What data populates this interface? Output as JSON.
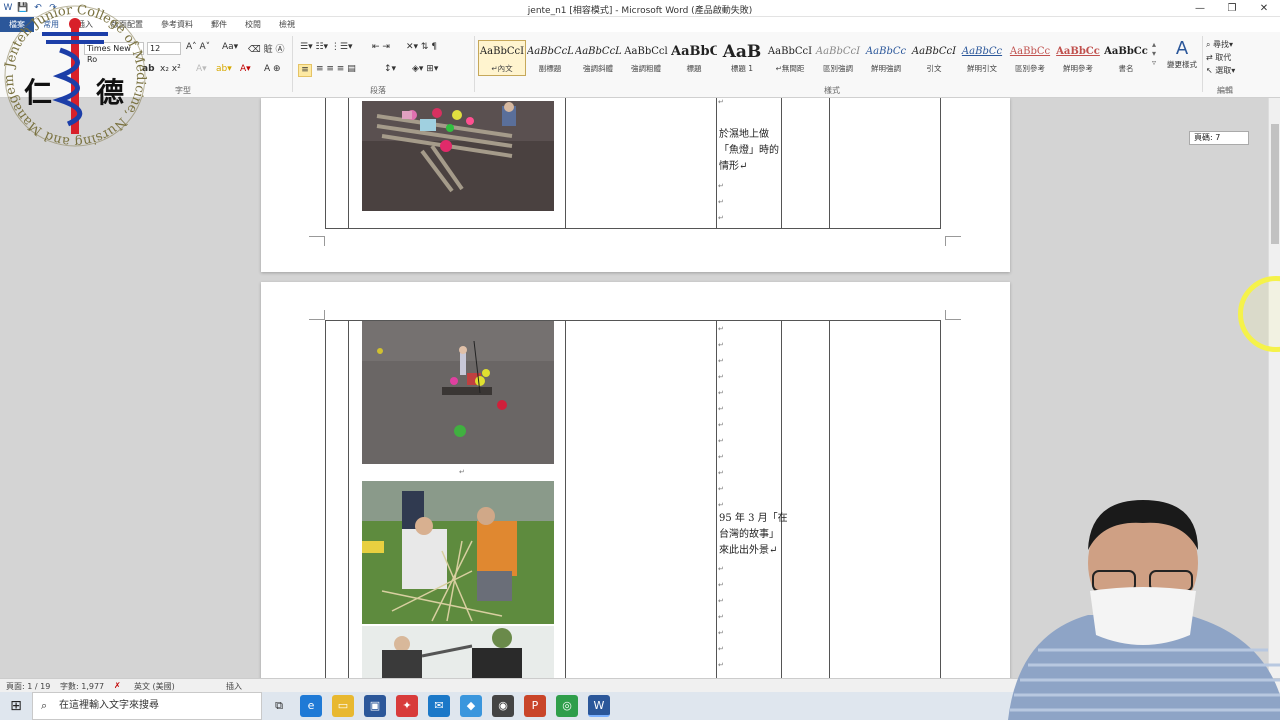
{
  "window": {
    "title": "jente_n1 [相容模式] - Microsoft Word (產品啟動失敗)",
    "minimize": "—",
    "restore": "❐",
    "close": "✕"
  },
  "quick_access": [
    "W",
    "💾",
    "↶",
    "↷"
  ],
  "tabs": [
    {
      "label": "檔案"
    },
    {
      "label": "常用"
    },
    {
      "label": "插入"
    },
    {
      "label": "版面配置"
    },
    {
      "label": "參考資料"
    },
    {
      "label": "郵件"
    },
    {
      "label": "校閱"
    },
    {
      "label": "檢視"
    }
  ],
  "ribbon": {
    "font_name": "Times New Ro",
    "font_size": "12",
    "group_font": "字型",
    "group_paragraph": "段落",
    "group_styles": "樣式",
    "group_editing": "編輯",
    "change_styles": "變更樣式",
    "find": "尋找",
    "replace": "取代",
    "select": "選取",
    "styles": [
      {
        "preview": "AaBbCcI",
        "name": "↵內文"
      },
      {
        "preview": "AaBbCcL",
        "name": "副標題"
      },
      {
        "preview": "AaBbCcL",
        "name": "強調斜體"
      },
      {
        "preview": "AaBbCcl",
        "name": "強調粗體"
      },
      {
        "preview": "AaBbC",
        "name": "標題"
      },
      {
        "preview": "AaB",
        "name": "標題 1"
      },
      {
        "preview": "AaBbCcI",
        "name": "↵無間距"
      },
      {
        "preview": "AaBbCcI",
        "name": "區別強調"
      },
      {
        "preview": "AaBbCc",
        "name": "鮮明強調"
      },
      {
        "preview": "AaBbCcI",
        "name": "引文"
      },
      {
        "preview": "AaBbCc",
        "name": "鮮明引文"
      },
      {
        "preview": "AaBbCc",
        "name": "區別參考"
      },
      {
        "preview": "AaBbCc",
        "name": "鮮明參考"
      },
      {
        "preview": "AaBbCc",
        "name": "書名"
      }
    ]
  },
  "document": {
    "page1_cell_text": [
      "於濕地上做",
      "「魚燈」時的",
      "情形↵"
    ],
    "page2_cell_text": [
      "95 年 3 月「在",
      "台灣的故事」",
      "來此出外景↵"
    ],
    "para_mark": "↵"
  },
  "page_tip": "頁碼: 7",
  "status": {
    "page": "頁面: 1 / 19",
    "words": "字數: 1,977",
    "language": "英文 (美國)",
    "mode": "插入"
  },
  "taskbar": {
    "search_placeholder": "在這裡輸入文字來搜尋",
    "apps": [
      "task-view",
      "edge",
      "explorer",
      "store",
      "gift",
      "mail",
      "photos",
      "media",
      "powerpoint",
      "chrome",
      "word"
    ]
  },
  "logo": {
    "text_ring": "Jenteh Junior College of Medicine, Nursing and Management",
    "chars": "仁 德"
  },
  "colors": {
    "word_blue": "#2b579a",
    "ribbon_bg": "#f8f8f8",
    "doc_bg": "#d4d4d4",
    "cursor_ring": "#f5f24a"
  }
}
